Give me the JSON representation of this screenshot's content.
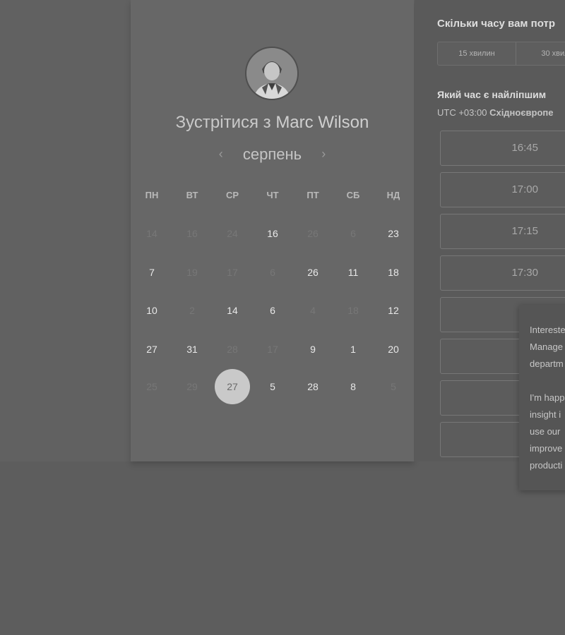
{
  "calendar": {
    "title_prefix": "Зустрітися з",
    "host_name": "Marc Wilson",
    "month": "серпень",
    "prev_icon": "‹",
    "next_icon": "›",
    "weekdays": [
      "ПН",
      "ВТ",
      "СР",
      "ЧТ",
      "ПТ",
      "СБ",
      "НД"
    ],
    "weeks": [
      [
        {
          "d": "14",
          "a": false
        },
        {
          "d": "16",
          "a": false
        },
        {
          "d": "24",
          "a": false
        },
        {
          "d": "16",
          "a": true
        },
        {
          "d": "26",
          "a": false
        },
        {
          "d": "6",
          "a": false
        },
        {
          "d": "23",
          "a": true
        }
      ],
      [
        {
          "d": "7",
          "a": true
        },
        {
          "d": "19",
          "a": false
        },
        {
          "d": "17",
          "a": false
        },
        {
          "d": "6",
          "a": false
        },
        {
          "d": "26",
          "a": true
        },
        {
          "d": "11",
          "a": true
        },
        {
          "d": "18",
          "a": true
        }
      ],
      [
        {
          "d": "10",
          "a": true
        },
        {
          "d": "2",
          "a": false
        },
        {
          "d": "14",
          "a": true
        },
        {
          "d": "6",
          "a": true
        },
        {
          "d": "4",
          "a": false
        },
        {
          "d": "18",
          "a": false
        },
        {
          "d": "12",
          "a": true
        }
      ],
      [
        {
          "d": "27",
          "a": true
        },
        {
          "d": "31",
          "a": true
        },
        {
          "d": "28",
          "a": false
        },
        {
          "d": "17",
          "a": false
        },
        {
          "d": "9",
          "a": true
        },
        {
          "d": "1",
          "a": true
        },
        {
          "d": "20",
          "a": true
        }
      ],
      [
        {
          "d": "25",
          "a": false
        },
        {
          "d": "29",
          "a": false
        },
        {
          "d": "27",
          "a": true,
          "selected": true
        },
        {
          "d": "5",
          "a": true
        },
        {
          "d": "28",
          "a": true
        },
        {
          "d": "8",
          "a": true
        },
        {
          "d": "5",
          "a": false
        }
      ]
    ]
  },
  "right": {
    "duration_question": "Скільки часу вам потр",
    "durations": [
      "15 хвилин",
      "30 хвил"
    ],
    "time_question": "Який час є найліпшим",
    "tz_offset": "UTC +03:00",
    "tz_name": "Східноєвропе",
    "slots": [
      "16:45",
      "17:00",
      "17:15",
      "17:30",
      "",
      "",
      "",
      ""
    ]
  },
  "popup": {
    "lines": [
      "Intereste",
      "Manage",
      "departm",
      "",
      "I'm happ",
      "insight i",
      "use our",
      "improve",
      "producti"
    ]
  },
  "colors": {
    "selected_day": "#c9c9c9",
    "card": "#676767"
  }
}
